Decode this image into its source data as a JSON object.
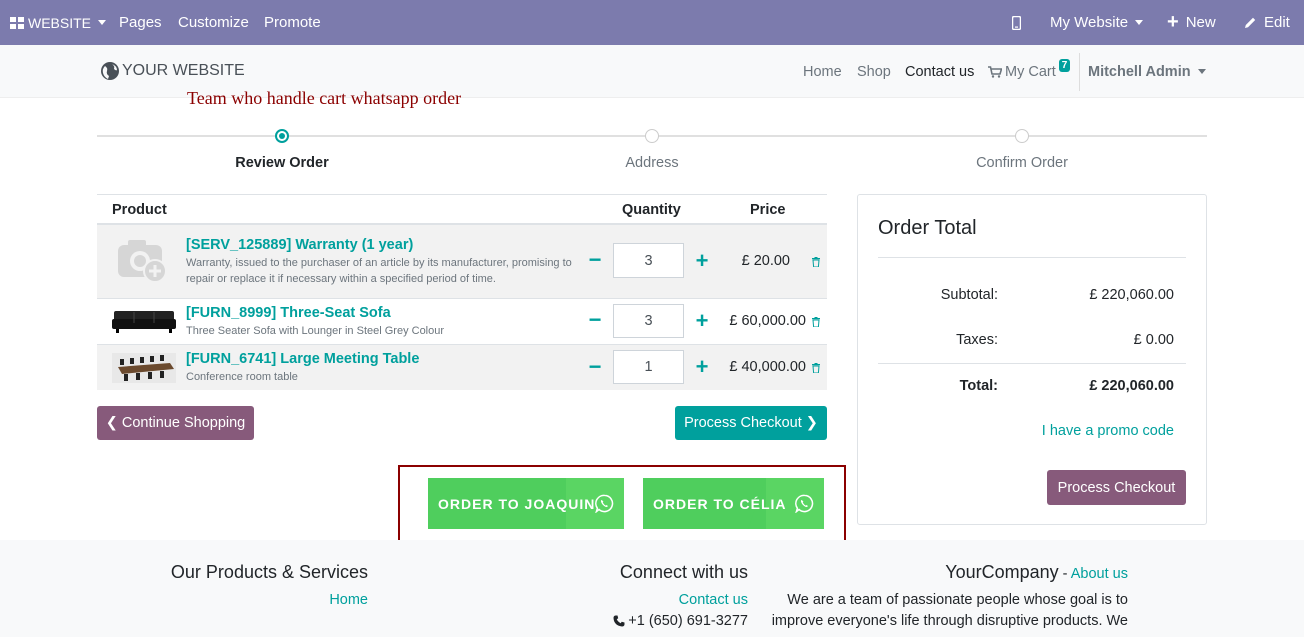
{
  "adminbar": {
    "website": "WEBSITE",
    "pages": "Pages",
    "customize": "Customize",
    "promote": "Promote",
    "my_website": "My Website",
    "new": "New",
    "edit": "Edit"
  },
  "header": {
    "logo": "YOUR WEBSITE",
    "nav": [
      "Home",
      "Shop",
      "Contact us"
    ],
    "cart_label": "My Cart",
    "cart_count": "7",
    "user": "Mitchell Admin"
  },
  "annotation": "Team who handle cart whatsapp order",
  "wizard": {
    "steps": [
      "Review Order",
      "Address",
      "Confirm Order"
    ]
  },
  "cart": {
    "headers": {
      "product": "Product",
      "quantity": "Quantity",
      "price": "Price"
    },
    "rows": [
      {
        "name": "[SERV_125889] Warranty (1 year)",
        "description": "Warranty, issued to the purchaser of an article by its manufacturer, promising to repair or replace it if necessary within a specified period of time.",
        "qty": "3",
        "price": "£ 20.00"
      },
      {
        "name": "[FURN_8999] Three-Seat Sofa",
        "description": "Three Seater Sofa with Lounger in Steel Grey Colour",
        "qty": "3",
        "price": "£ 60,000.00"
      },
      {
        "name": "[FURN_6741] Large Meeting Table",
        "description": "Conference room table",
        "qty": "1",
        "price": "£ 40,000.00"
      }
    ],
    "minus": "−",
    "plus": "+",
    "continue": "Continue Shopping",
    "process": "Process Checkout"
  },
  "whatsapp": {
    "btn1": "ORDER TO JOAQUIN",
    "btn2": "ORDER TO CÉLIA"
  },
  "order_total": {
    "title": "Order Total",
    "subtotal_label": "Subtotal:",
    "subtotal": "£ 220,060.00",
    "taxes_label": "Taxes:",
    "taxes": "£ 0.00",
    "total_label": "Total:",
    "total": "£ 220,060.00",
    "promo": "I have a promo code",
    "process": "Process Checkout"
  },
  "footer": {
    "col1_title": "Our Products & Services",
    "col1_link": "Home",
    "col2_title": "Connect with us",
    "col2_link": "Contact us",
    "col2_phone": "+1 (650) 691-3277",
    "col3_title": "YourCompany",
    "col3_sep": " - ",
    "col3_link": "About us",
    "col3_text1": "We are a team of passionate people whose goal is to",
    "col3_text2": "improve everyone's life through disruptive products. We"
  },
  "colors": {
    "adminbar": "#7c7bad",
    "primary": "#00a09d",
    "secondary": "#875a7b",
    "whatsapp": "#4fce5d",
    "annotation": "#8b0000"
  }
}
